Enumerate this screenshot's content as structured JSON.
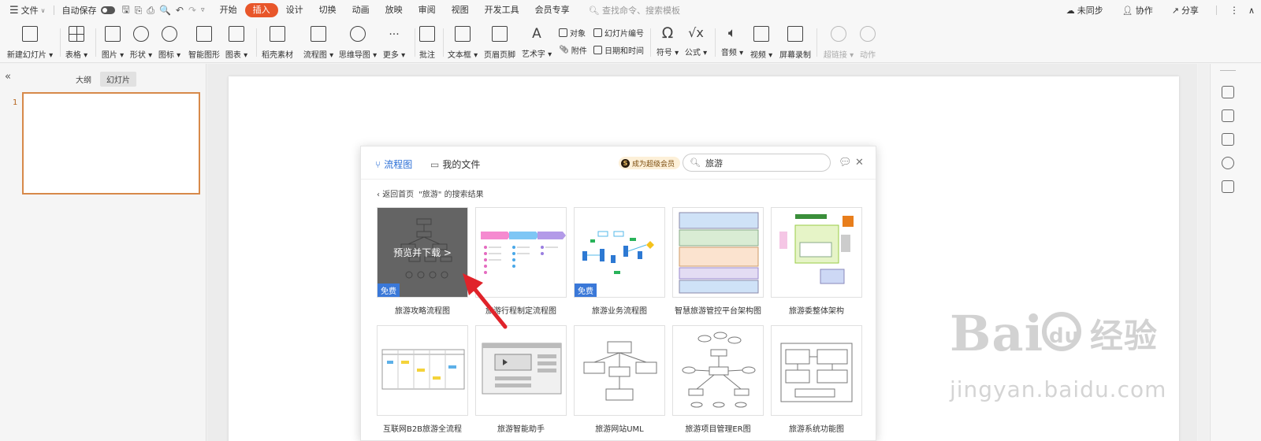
{
  "menubar": {
    "file": "文件",
    "autosave": "自动保存",
    "tabs": [
      "开始",
      "插入",
      "设计",
      "切换",
      "动画",
      "放映",
      "审阅",
      "视图",
      "开发工具",
      "会员专享"
    ],
    "active_tab": "插入",
    "search_placeholder": "查找命令、搜索模板",
    "sync": "未同步",
    "collab": "协作",
    "share": "分享"
  },
  "ribbon": {
    "new_slide": "新建幻灯片",
    "table": "表格",
    "picture": "图片",
    "shape": "形状",
    "icon": "图标",
    "smartart": "智能图形",
    "chart": "图表",
    "material": "稻壳素材",
    "flowchart": "流程图",
    "mindmap": "思维导图",
    "more": "更多",
    "comment": "批注",
    "textbox": "文本框",
    "header_footer": "页眉页脚",
    "wordart": "艺术字",
    "object": "对象",
    "attachment": "附件",
    "slide_number": "幻灯片编号",
    "datetime": "日期和时间",
    "symbol": "符号",
    "formula": "公式",
    "audio": "音频",
    "video": "视频",
    "screen_record": "屏幕录制",
    "hyperlink": "超链接",
    "action": "动作"
  },
  "leftpanel": {
    "outline_tab": "大纲",
    "slides_tab": "幻灯片",
    "slide_number": "1"
  },
  "dialog": {
    "tab_flowchart": "流程图",
    "tab_myfiles": "我的文件",
    "vip_badge": "成为超级会员",
    "search_value": "旅游",
    "back": "返回首页",
    "result_label": "\"旅游\" 的搜索结果",
    "hover_text": "预览并下载 >",
    "free_badge": "免费",
    "templates_row1": [
      "旅游攻略流程图",
      "旅游行程制定流程图",
      "旅游业务流程图",
      "智慧旅游管控平台架构图",
      "旅游委整体架构"
    ],
    "templates_row2": [
      "互联网B2B旅游全流程",
      "旅游智能助手",
      "旅游网站UML",
      "旅游项目管理ER图",
      "旅游系统功能图"
    ]
  },
  "watermark": {
    "logo": "Bai du 经验",
    "url": "jingyan.baidu.com"
  },
  "colors": {
    "accent": "#e8562a",
    "link_blue": "#2b6fd6",
    "free_badge": "#3a78d8",
    "arrow": "#e0232a"
  }
}
